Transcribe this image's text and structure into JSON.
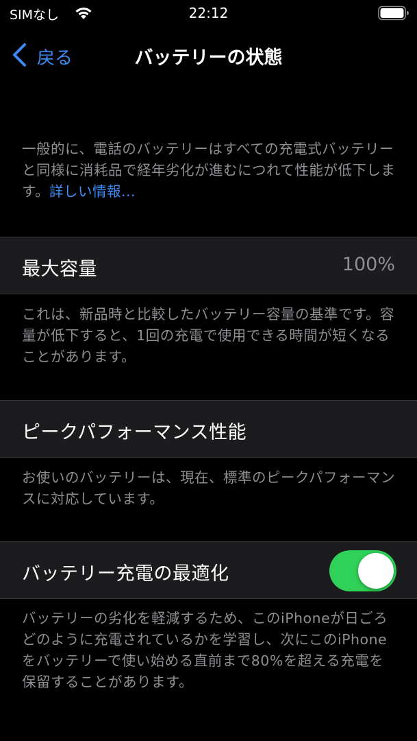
{
  "status_bar": {
    "carrier": "SIMなし",
    "time": "22:12",
    "wifi_icon": "wifi-icon",
    "battery_icon": "battery-full-icon"
  },
  "nav": {
    "back_label": "戻る",
    "back_icon": "chevron-left-icon",
    "title": "バッテリーの状態"
  },
  "intro": {
    "text": "一般的に、電話のバッテリーはすべての充電式バッテリーと同様に消耗品で経年劣化が進むにつれて性能が低下します。",
    "link": "詳しい情報..."
  },
  "max_capacity": {
    "label": "最大容量",
    "value": "100%",
    "note": "これは、新品時と比較したバッテリー容量の基準です。容量が低下すると、1回の充電で使用できる時間が短くなることがあります。"
  },
  "peak_performance": {
    "label": "ピークパフォーマンス性能",
    "note": "お使いのバッテリーは、現在、標準のピークパフォーマンスに対応しています。"
  },
  "optimized_charging": {
    "label": "バッテリー充電の最適化",
    "enabled": true,
    "note": "バッテリーの劣化を軽減するため、このiPhoneが日ごろどのように充電されているかを学習し、次にこのiPhoneをバッテリーで使い始める直前まで80%を超える充電を保留することがあります。"
  },
  "colors": {
    "background": "#000000",
    "cell_background": "#1c1c1e",
    "secondary_text": "#8e8e93",
    "accent_blue": "#3d8bf2",
    "toggle_on": "#30d158"
  }
}
